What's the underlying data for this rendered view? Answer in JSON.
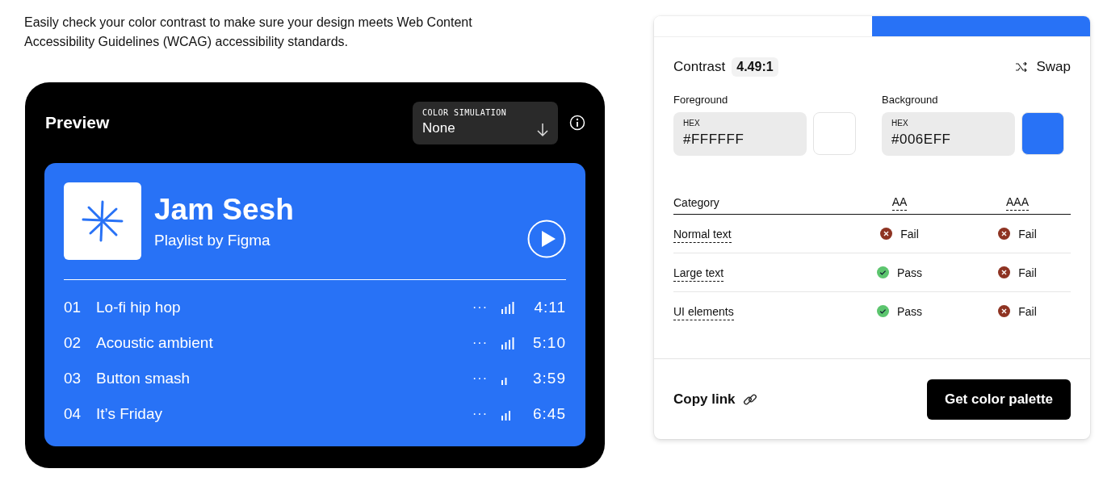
{
  "intro": "Easily check your color contrast to make sure your design meets Web Content Accessibility Guidelines (WCAG) accessibility standards.",
  "preview": {
    "title": "Preview",
    "simulation": {
      "label": "COLOR SIMULATION",
      "value": "None"
    },
    "playlist": {
      "title": "Jam Sesh",
      "subtitle": "Playlist by Figma",
      "tracks": [
        {
          "number": "01",
          "name": "Lo-fi hip hop",
          "more": "···",
          "kind": "high",
          "duration": "4:11"
        },
        {
          "number": "02",
          "name": "Acoustic ambient",
          "more": "···",
          "kind": "high",
          "duration": "5:10"
        },
        {
          "number": "03",
          "name": "Button smash",
          "more": "···",
          "kind": "low",
          "duration": "3:59"
        },
        {
          "number": "04",
          "name": "It’s Friday",
          "more": "···",
          "kind": "medium",
          "duration": "6:45"
        }
      ]
    }
  },
  "checker": {
    "contrast_label": "Contrast",
    "ratio": "4.49:1",
    "swap": "Swap",
    "colors": [
      {
        "label": "Foreground",
        "field_label": "HEX",
        "value": "#FFFFFF",
        "color": "#ffffff"
      },
      {
        "label": "Background",
        "field_label": "HEX",
        "value": "#006EFF",
        "color": "#2872f6"
      }
    ],
    "table": {
      "columns": [
        "Category",
        "AA",
        "AAA"
      ],
      "rows": [
        {
          "category": "Normal text",
          "results": [
            {
              "text": "Fail",
              "pass": false
            },
            {
              "text": "Fail",
              "pass": false
            }
          ]
        },
        {
          "category": "Large text",
          "results": [
            {
              "text": "Pass",
              "pass": true
            },
            {
              "text": "Fail",
              "pass": false
            }
          ]
        },
        {
          "category": "UI elements",
          "results": [
            {
              "text": "Pass",
              "pass": true
            },
            {
              "text": "Fail",
              "pass": false
            }
          ]
        }
      ]
    },
    "copy_link": "Copy link",
    "palette_button": "Get color palette"
  }
}
